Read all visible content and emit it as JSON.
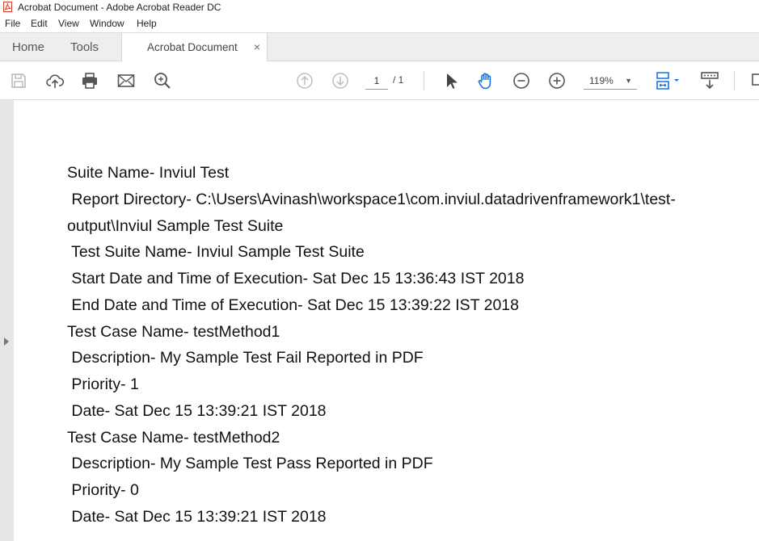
{
  "window": {
    "title": "Acrobat Document - Adobe Acrobat Reader DC"
  },
  "menu": [
    "File",
    "Edit",
    "View",
    "Window",
    "Help"
  ],
  "tabs": {
    "home": "Home",
    "tools": "Tools",
    "document": "Acrobat Document",
    "close_glyph": "×"
  },
  "toolbar": {
    "page_current": "1",
    "page_total": "/ 1",
    "zoom": "119%",
    "icons": [
      "save-icon",
      "cloud-upload-icon",
      "print-icon",
      "email-icon",
      "search-zoom-icon",
      "page-up-icon",
      "page-down-icon",
      "select-arrow-icon",
      "hand-tool-icon",
      "zoom-out-icon",
      "zoom-in-icon",
      "fit-page-icon",
      "read-mode-icon"
    ],
    "accent": "#1473e6"
  },
  "document": {
    "lines": [
      "Suite Name- Inviul Test",
      " Report Directory- C:\\Users\\Avinash\\workspace1\\com.inviul.datadrivenframework1\\test-",
      "output\\Inviul Sample Test Suite",
      " Test Suite Name- Inviul Sample Test Suite",
      " Start Date and Time of Execution- Sat Dec 15 13:36:43 IST 2018",
      " End Date and Time of Execution- Sat Dec 15 13:39:22 IST 2018",
      "Test Case Name- testMethod1",
      " Description- My Sample Test Fail Reported in PDF",
      " Priority- 1",
      " Date- Sat Dec 15 13:39:21 IST 2018",
      "Test Case Name- testMethod2",
      " Description- My Sample Test Pass Reported in PDF",
      " Priority- 0",
      " Date- Sat Dec 15 13:39:21 IST 2018"
    ]
  }
}
